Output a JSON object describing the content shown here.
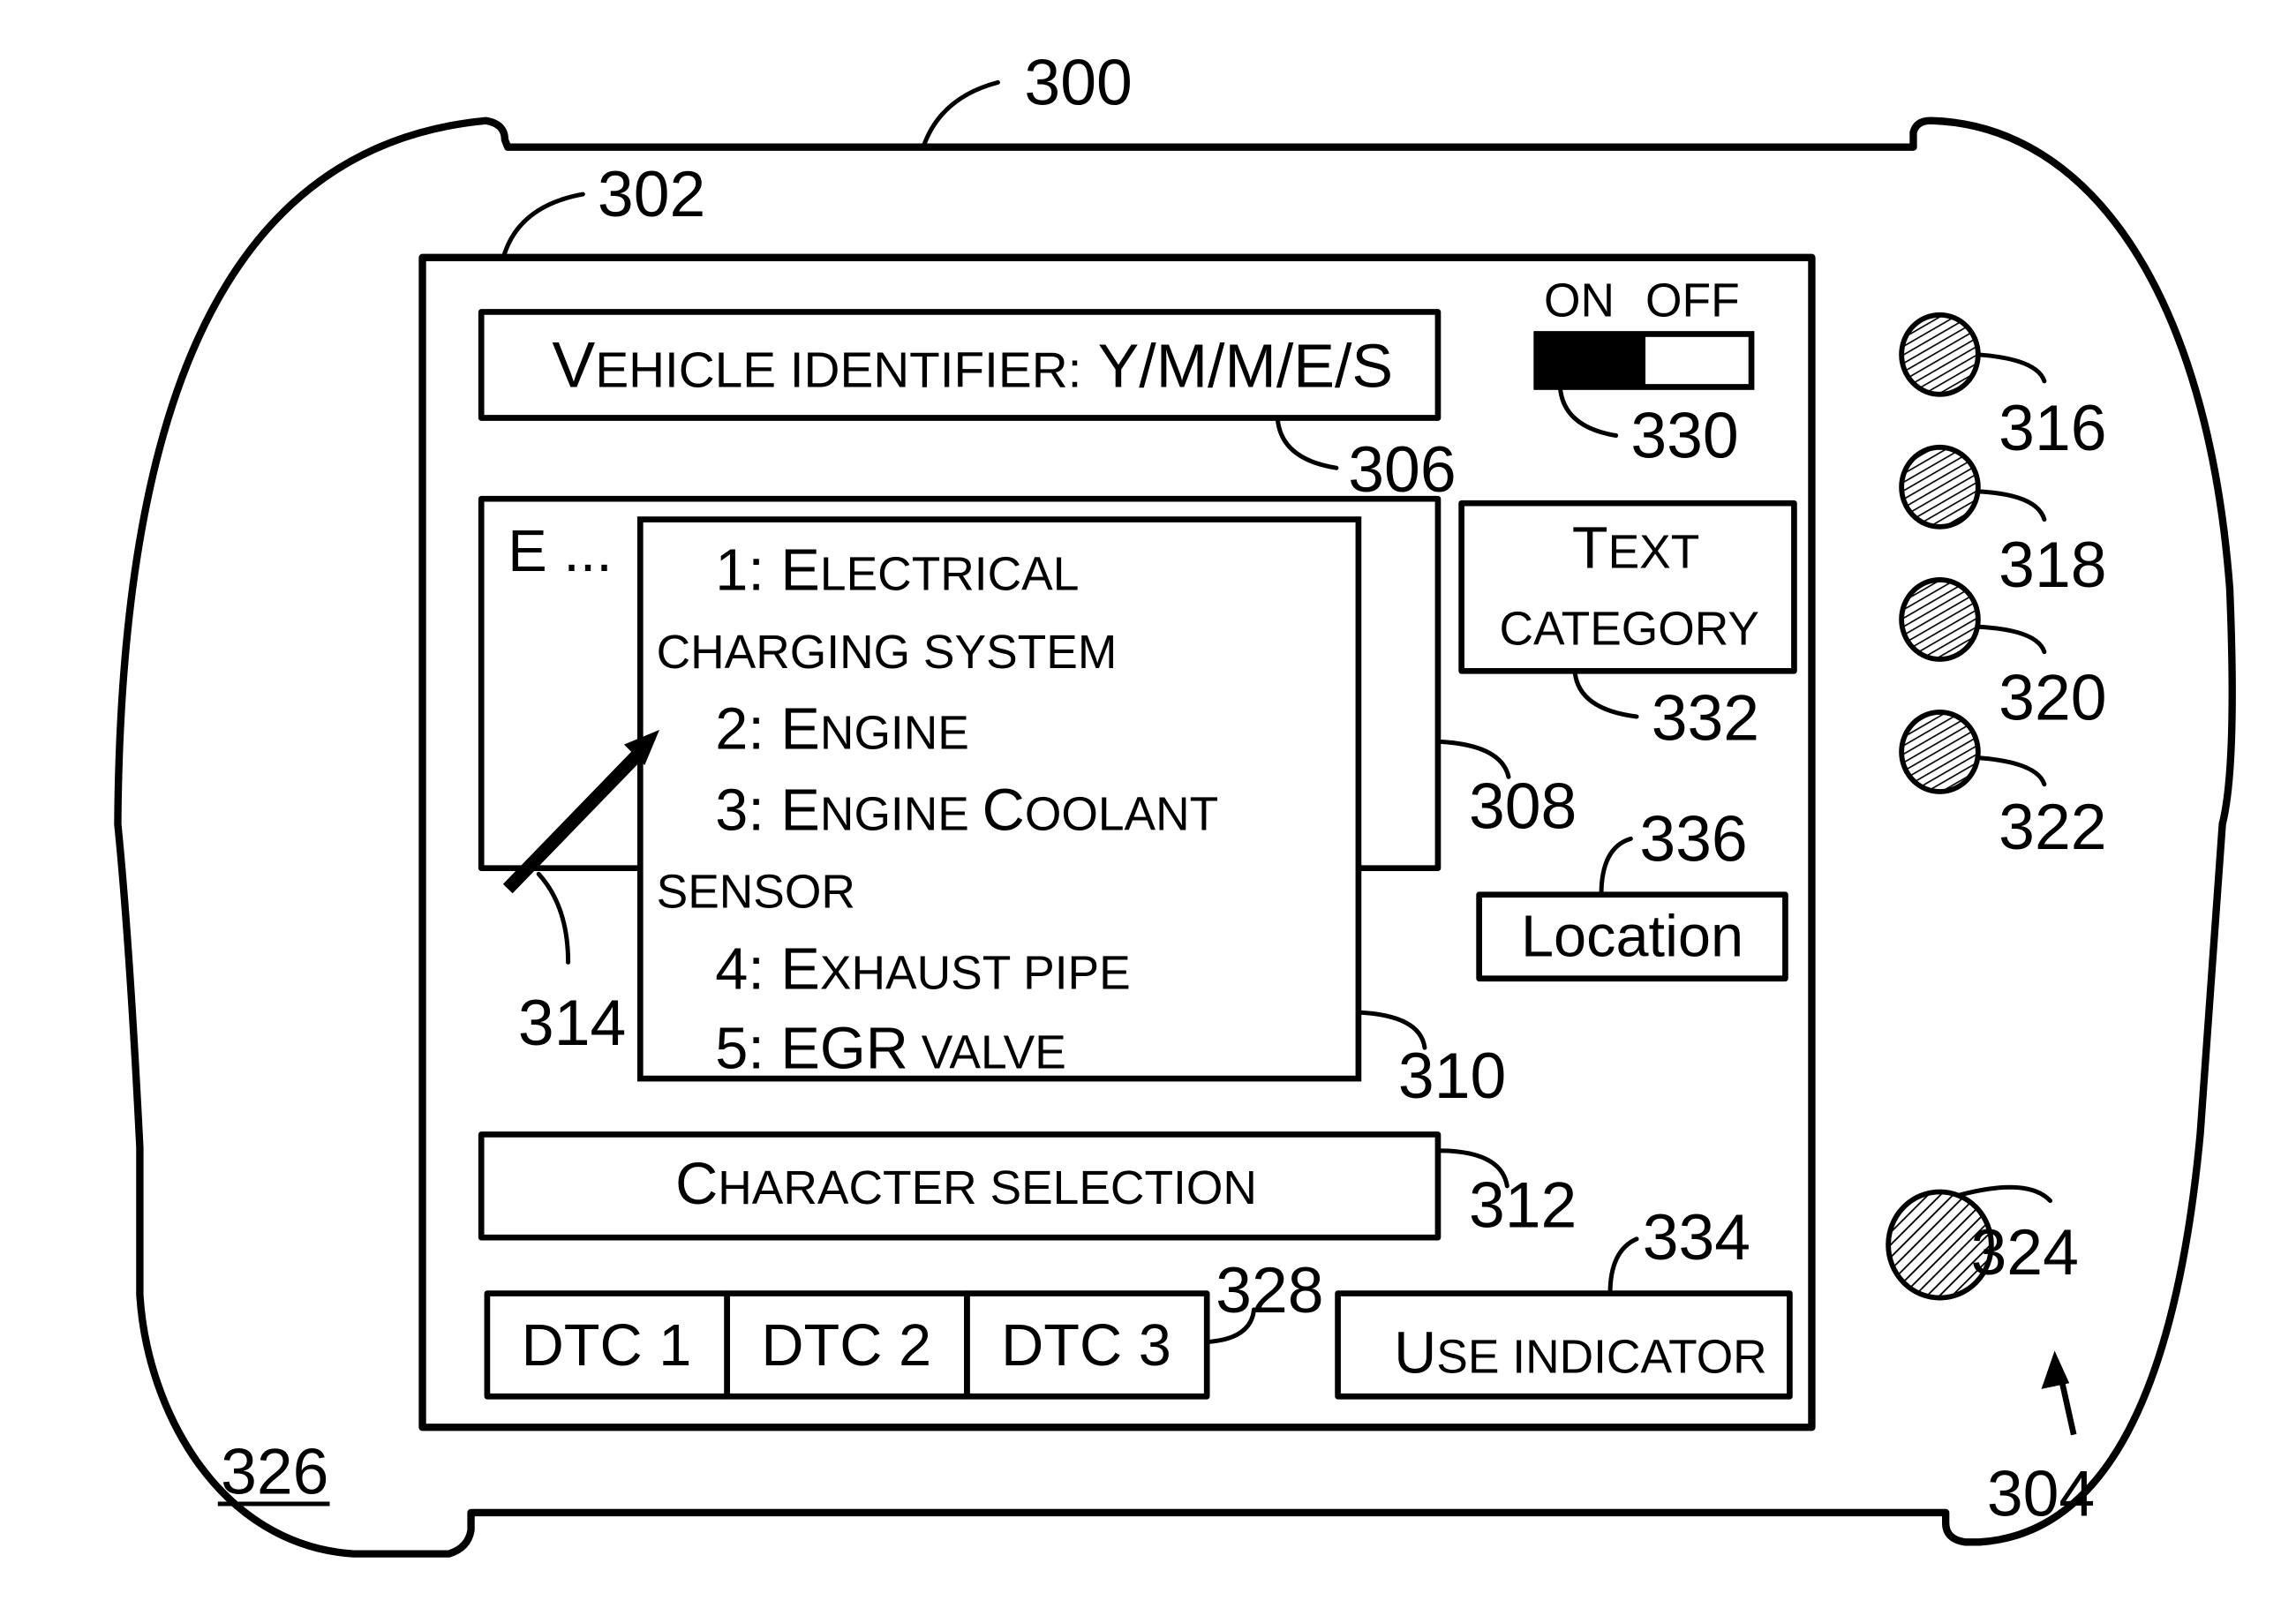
{
  "figure": {
    "device_ref": "300",
    "screen_ref": "302",
    "button_panel_ref": "304",
    "housing_ref": "326"
  },
  "screen": {
    "vehicle_identifier": {
      "ref": "306",
      "label_big": "V",
      "label_small": "EHICLE IDENTIFIER:",
      "value": " Y/M/M/E/S"
    },
    "power_switch": {
      "ref": "330",
      "on_label": "ON",
      "off_label": "OFF",
      "state": "on"
    },
    "text_entry": {
      "ref": "308",
      "value": "E ..."
    },
    "text_category_button": {
      "ref": "332",
      "line1_big": "T",
      "line1_small": "EXT",
      "line2": "CATEGORY"
    },
    "location_button": {
      "ref": "336",
      "label": "Location"
    },
    "suggestion_list": {
      "ref": "310",
      "items": [
        {
          "num": "1: ",
          "big": "E",
          "small": "LECTRICAL",
          "line2": "CHARGING SYSTEM"
        },
        {
          "num": "2: ",
          "big": "E",
          "small": "NGINE",
          "line2": ""
        },
        {
          "num": "3: ",
          "big": "E",
          "small": "NGINE ",
          "big2": "C",
          "small2": "OOLANT",
          "line2": "SENSOR"
        },
        {
          "num": "4: ",
          "big": "E",
          "small": "XHAUST PIPE",
          "line2": ""
        },
        {
          "num": "5: ",
          "big": "EGR",
          "small": " VALVE",
          "line2": ""
        }
      ]
    },
    "pointer": {
      "ref": "314"
    },
    "character_selection": {
      "ref": "312",
      "label_big": "C",
      "label_small": "HARACTER SELECTION"
    },
    "dtc_buttons": {
      "ref": "328",
      "items": [
        "DTC 1",
        "DTC 2",
        "DTC 3"
      ]
    },
    "use_indicator": {
      "ref": "334",
      "label_big": "U",
      "label_small": "SE INDICATOR"
    }
  },
  "hardware_buttons": [
    {
      "ref": "316"
    },
    {
      "ref": "318"
    },
    {
      "ref": "320"
    },
    {
      "ref": "322"
    },
    {
      "ref": "324"
    }
  ]
}
